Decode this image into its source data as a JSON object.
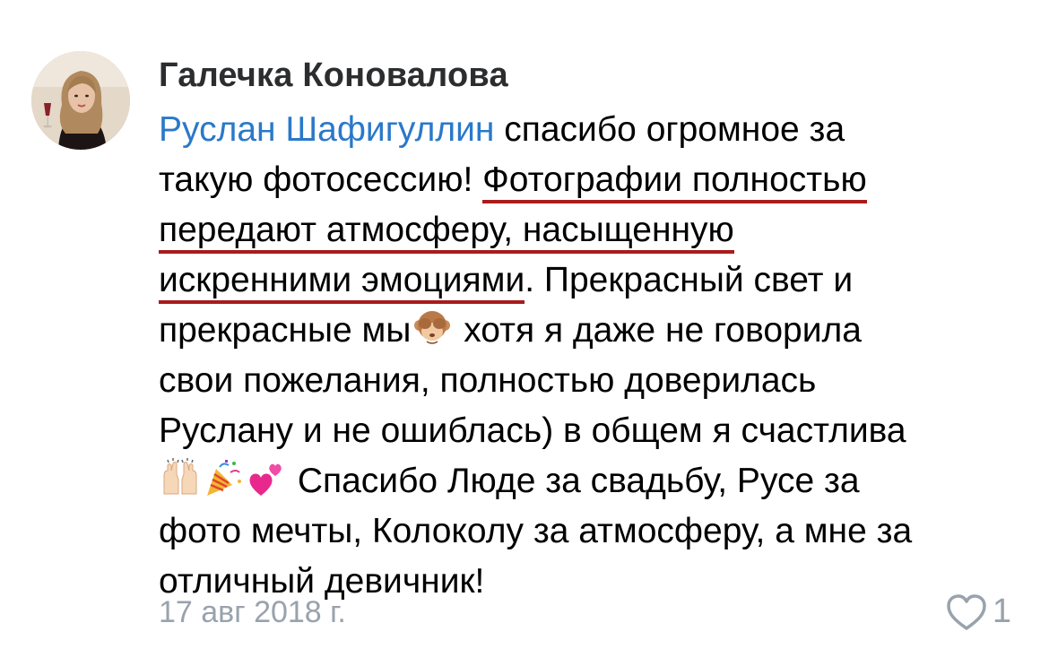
{
  "comment": {
    "author": "Галечка Коновалова",
    "mention": "Руслан Шафигуллин",
    "lines": {
      "l1_rest": " спасибо огромное за",
      "l2_start": "такую фотосессию! ",
      "l2_underlined": "Фотографии полностью",
      "l3_underlined": "передают атмосферу, насыщенную",
      "l4_underlined": "искренними эмоциями",
      "l4_rest": ". Прекрасный свет и",
      "l5_start": "прекрасные мы",
      "l5_rest": " хотя я даже не говорила",
      "l6": "свои пожелания, полностью доверилась",
      "l7": "Руслану и не ошиблась) в общем я счастлива",
      "l8_rest": " Спасибо Люде за свадьбу, Русе за",
      "l9": "фото мечты, Колоколу за атмосферу, а мне за",
      "l10": "отличный девичник!"
    },
    "emojis": [
      "see-no-evil-monkey",
      "raising-hands",
      "party-popper",
      "two-hearts"
    ],
    "date": "17 авг 2018 г.",
    "likes_count": "1",
    "colors": {
      "mention": "#2a79c9",
      "underline": "#a81c1c",
      "meta": "#99a2ad",
      "author": "#2c2d2e"
    }
  }
}
